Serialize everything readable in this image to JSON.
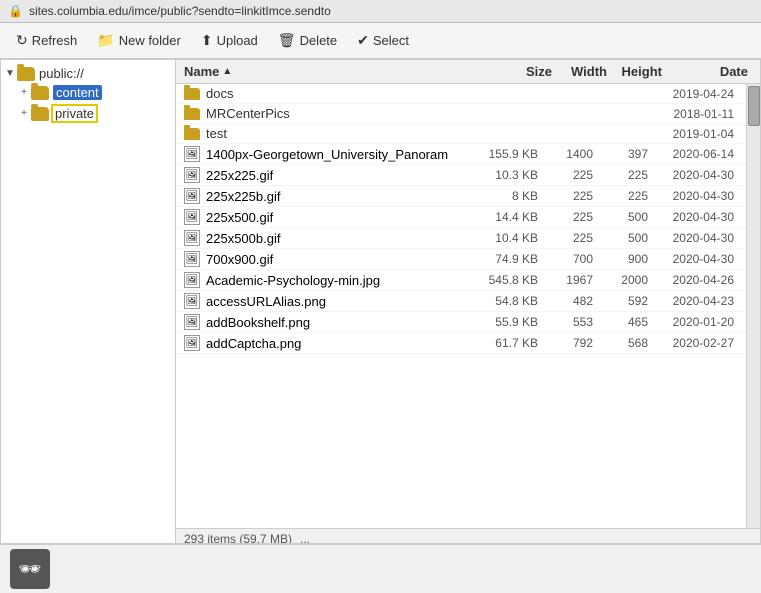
{
  "titlebar": {
    "url": "sites.columbia.edu/imce/public?sendto=linkitImce.sendto",
    "lock_icon": "🔒"
  },
  "toolbar": {
    "refresh_label": "Refresh",
    "new_folder_label": "New folder",
    "upload_label": "Upload",
    "delete_label": "Delete",
    "select_label": "Select"
  },
  "tree": {
    "root_label": "public://",
    "children": [
      {
        "label": "content",
        "selected": true,
        "highlighted": false
      },
      {
        "label": "private",
        "selected": false,
        "highlighted": true
      }
    ]
  },
  "file_table": {
    "headers": {
      "name": "Name",
      "sort_indicator": "▲",
      "size": "Size",
      "width": "Width",
      "height": "Height",
      "date": "Date"
    },
    "rows": [
      {
        "type": "folder",
        "name": "docs",
        "size": "",
        "width": "",
        "height": "",
        "date": "2019-04-24"
      },
      {
        "type": "folder",
        "name": "MRCenterPics",
        "size": "",
        "width": "",
        "height": "",
        "date": "2018-01-11"
      },
      {
        "type": "folder",
        "name": "test",
        "size": "",
        "width": "",
        "height": "",
        "date": "2019-01-04"
      },
      {
        "type": "image",
        "name": "1400px-Georgetown_University_Panoram",
        "size": "155.9 KB",
        "width": "1400",
        "height": "397",
        "date": "2020-06-14"
      },
      {
        "type": "image",
        "name": "225x225.gif",
        "size": "10.3 KB",
        "width": "225",
        "height": "225",
        "date": "2020-04-30"
      },
      {
        "type": "image",
        "name": "225x225b.gif",
        "size": "8 KB",
        "width": "225",
        "height": "225",
        "date": "2020-04-30"
      },
      {
        "type": "image",
        "name": "225x500.gif",
        "size": "14.4 KB",
        "width": "225",
        "height": "500",
        "date": "2020-04-30"
      },
      {
        "type": "image",
        "name": "225x500b.gif",
        "size": "10.4 KB",
        "width": "225",
        "height": "500",
        "date": "2020-04-30"
      },
      {
        "type": "image",
        "name": "700x900.gif",
        "size": "74.9 KB",
        "width": "700",
        "height": "900",
        "date": "2020-04-30"
      },
      {
        "type": "image",
        "name": "Academic-Psychology-min.jpg",
        "size": "545.8 KB",
        "width": "1967",
        "height": "2000",
        "date": "2020-04-26"
      },
      {
        "type": "image",
        "name": "accessURLAlias.png",
        "size": "54.8 KB",
        "width": "482",
        "height": "592",
        "date": "2020-04-23"
      },
      {
        "type": "image",
        "name": "addBookshelf.png",
        "size": "55.9 KB",
        "width": "553",
        "height": "465",
        "date": "2020-01-20"
      },
      {
        "type": "image",
        "name": "addCaptcha.png",
        "size": "61.7 KB",
        "width": "792",
        "height": "568",
        "date": "2020-02-27"
      }
    ]
  },
  "statusbar": {
    "text": "293 items (59.7 MB)"
  },
  "bottom": {
    "eyeglass_icon": "🕶"
  }
}
